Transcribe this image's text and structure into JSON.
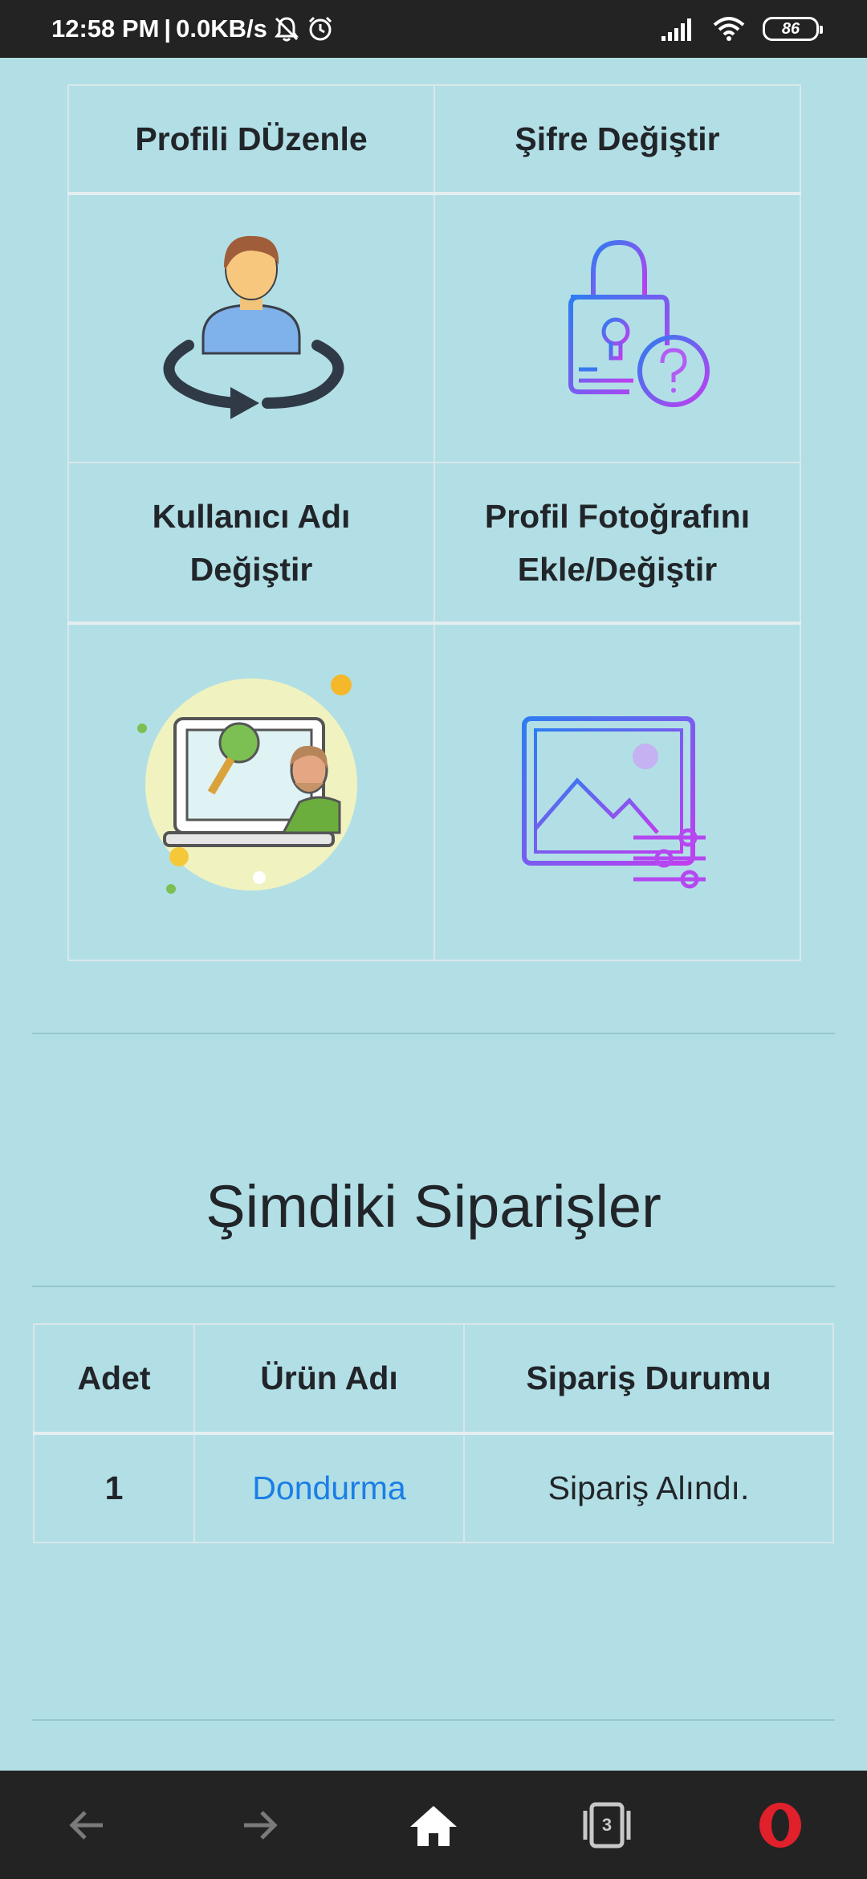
{
  "status_bar": {
    "time": "12:58 PM",
    "speed": "0.0KB/s",
    "battery": "86",
    "icons": [
      "mute-bell-icon",
      "alarm-icon",
      "signal-icon",
      "wifi-icon",
      "battery-icon"
    ]
  },
  "profile_menu": {
    "edit_profile": "Profili DÜzenle",
    "change_password": "Şifre Değiştir",
    "change_username_line1": "Kullanıcı Adı",
    "change_username_line2": "Değiştir",
    "photo_line1": "Profil Fotoğrafını",
    "photo_line2": "Ekle/Değiştir"
  },
  "orders": {
    "title": "Şimdiki Siparişler",
    "headers": [
      "Adet",
      "Ürün Adı",
      "Sipariş Durumu"
    ],
    "rows": [
      {
        "quantity": "1",
        "product": "Dondurma",
        "status": "Sipariş Alındı."
      }
    ]
  },
  "bottom_nav": {
    "tabs_count": "3",
    "icons": [
      "back-arrow-icon",
      "forward-arrow-icon",
      "home-icon",
      "tabs-icon",
      "opera-icon"
    ]
  }
}
